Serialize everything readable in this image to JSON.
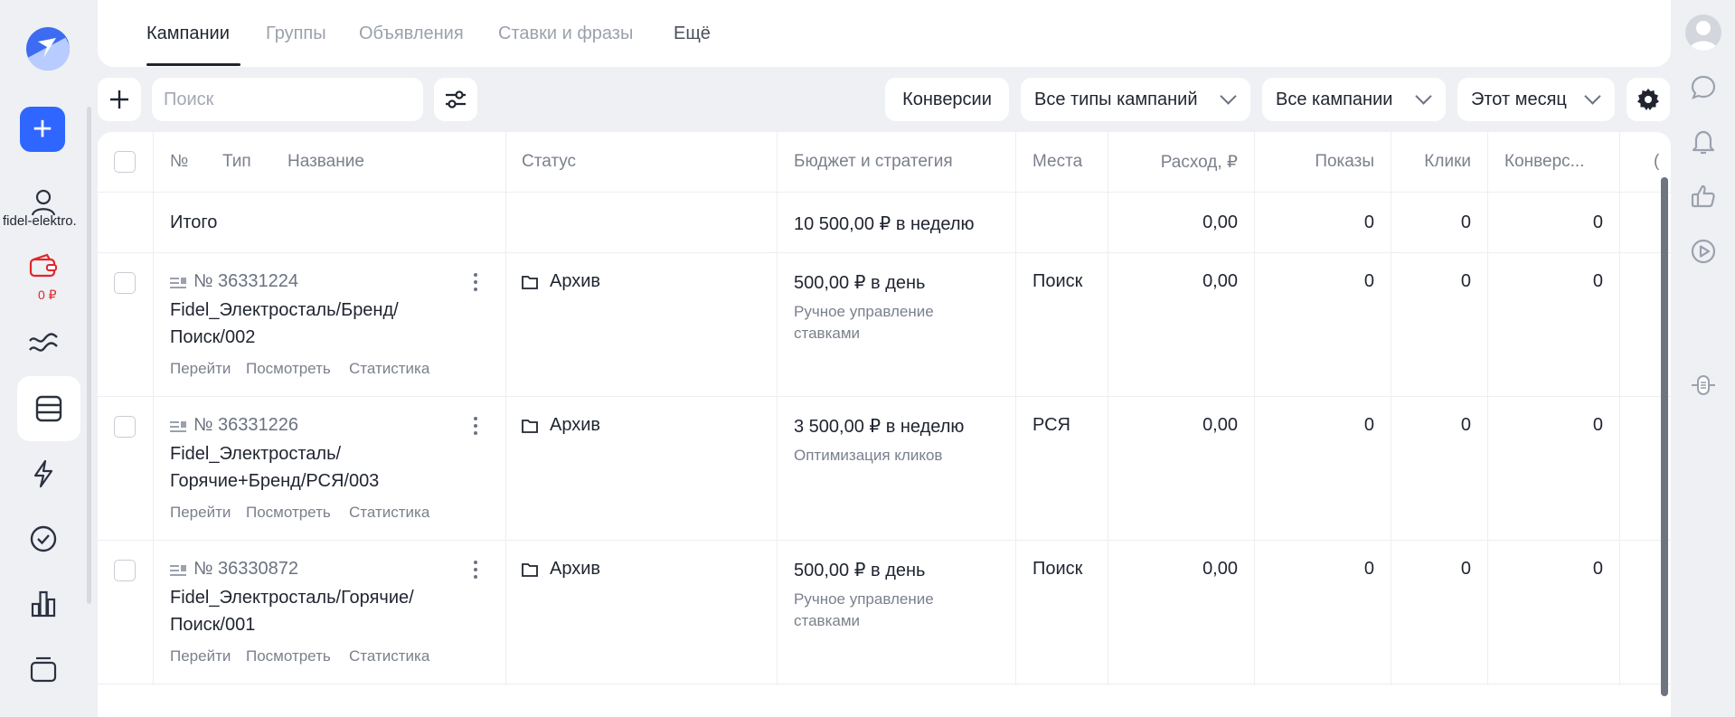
{
  "sidebar": {
    "account_label": "fidel-elektro.",
    "wallet_balance": "0 ₽",
    "icons": [
      "logo-icon",
      "add-icon",
      "user-icon",
      "wallet-icon",
      "wave-icon",
      "campaigns-icon",
      "lightning-icon",
      "check-circle-icon",
      "bar-chart-icon",
      "stack-icon"
    ]
  },
  "right_bar": {
    "icons": [
      "avatar-icon",
      "chat-icon",
      "bell-icon",
      "thumbs-up-icon",
      "play-icon",
      "resize-handle-icon"
    ]
  },
  "tabs": [
    {
      "label": "Кампании",
      "active": true
    },
    {
      "label": "Группы",
      "active": false
    },
    {
      "label": "Объявления",
      "active": false
    },
    {
      "label": "Ставки и фразы",
      "active": false
    },
    {
      "label": "Ещё",
      "active": false
    }
  ],
  "toolbar": {
    "search_placeholder": "Поиск",
    "conversions_label": "Конверсии",
    "campaign_types_label": "Все типы кампаний",
    "campaigns_filter_label": "Все кампании",
    "period_label": "Этот месяц"
  },
  "table": {
    "headers": {
      "number": "№",
      "type": "Тип",
      "name": "Название",
      "status": "Статус",
      "budget": "Бюджет и стратегия",
      "places": "Места",
      "spend": "Расход, ₽",
      "impressions": "Показы",
      "clicks": "Клики",
      "conversions": "Конверс...",
      "next": "("
    },
    "total": {
      "label": "Итого",
      "budget": "10 500,00 ₽ в неделю",
      "spend": "0,00",
      "impressions": "0",
      "clicks": "0",
      "conversions": "0"
    },
    "rows": [
      {
        "id": "№ 36331224",
        "name_line1": "Fidel_Электросталь/Бренд/",
        "name_line2": "Поиск/002",
        "actions": [
          "Перейти",
          "Посмотреть",
          "Статистика"
        ],
        "status": "Архив",
        "budget": "500,00 ₽ в день",
        "strategy_line1": "Ручное управление",
        "strategy_line2": "ставками",
        "places": "Поиск",
        "spend": "0,00",
        "impressions": "0",
        "clicks": "0",
        "conversions": "0"
      },
      {
        "id": "№ 36331226",
        "name_line1": "Fidel_Электросталь/",
        "name_line2": "Горячие+Бренд/РСЯ/003",
        "actions": [
          "Перейти",
          "Посмотреть",
          "Статистика"
        ],
        "status": "Архив",
        "budget": "3 500,00 ₽ в неделю",
        "strategy_line1": "Оптимизация кликов",
        "strategy_line2": "",
        "places": "РСЯ",
        "spend": "0,00",
        "impressions": "0",
        "clicks": "0",
        "conversions": "0"
      },
      {
        "id": "№ 36330872",
        "name_line1": "Fidel_Электросталь/Горячие/",
        "name_line2": "Поиск/001",
        "actions": [
          "Перейти",
          "Посмотреть",
          "Статистика"
        ],
        "status": "Архив",
        "budget": "500,00 ₽ в день",
        "strategy_line1": "Ручное управление",
        "strategy_line2": "ставками",
        "places": "Поиск",
        "spend": "0,00",
        "impressions": "0",
        "clicks": "0",
        "conversions": "0"
      }
    ]
  },
  "colors": {
    "accent": "#2f66ff",
    "background": "#eef0f4",
    "wallet_red": "#e0262b",
    "text": "#1f2430",
    "muted": "#a3a8b2"
  }
}
